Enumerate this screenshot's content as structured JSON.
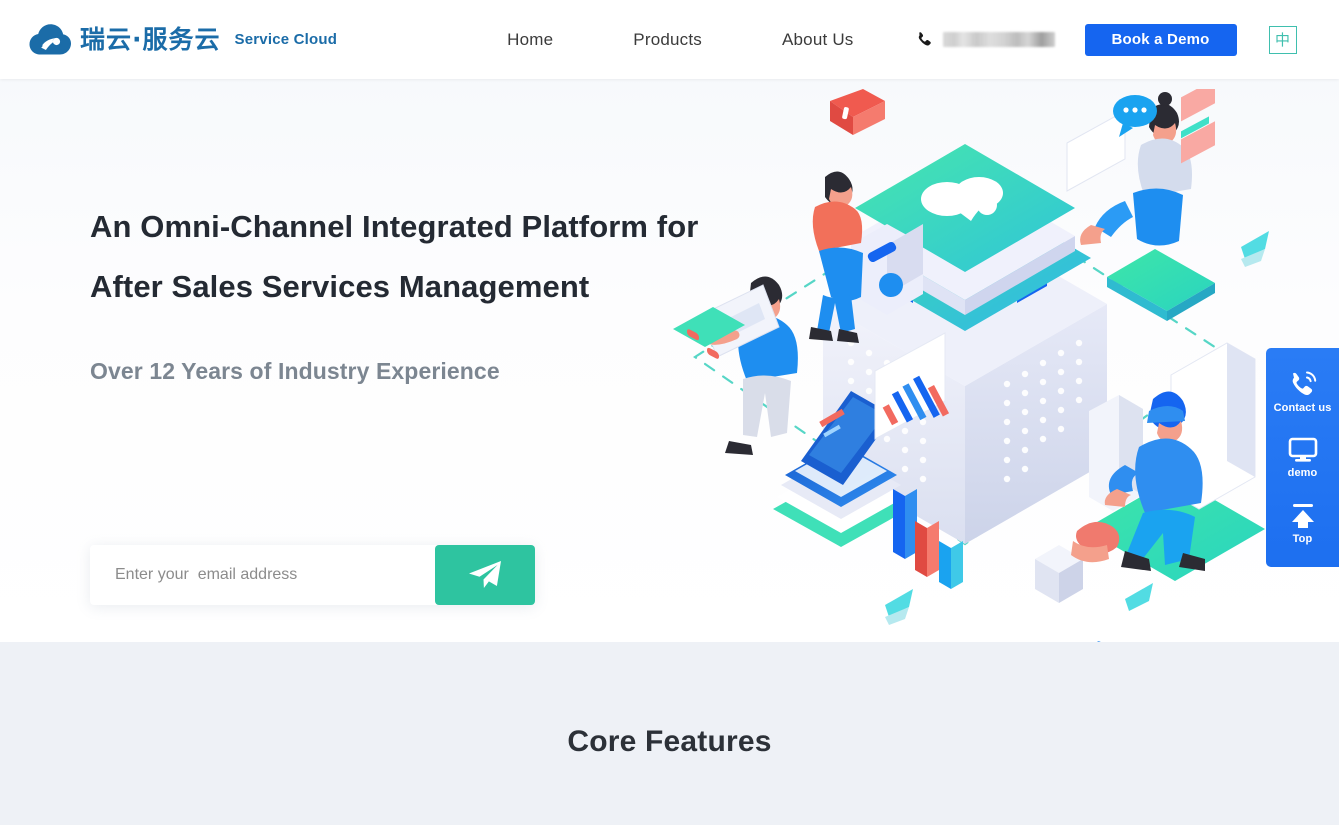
{
  "header": {
    "logo": {
      "icon": "cloud-logo-icon",
      "cn_text": "瑞云·服务云",
      "en_text": "Service Cloud",
      "color": "#1b6ca8"
    },
    "nav": [
      {
        "label": "Home",
        "name": "nav-home"
      },
      {
        "label": "Products",
        "name": "nav-products"
      },
      {
        "label": "About Us",
        "name": "nav-about-us"
      }
    ],
    "phone": {
      "icon": "phone-icon",
      "number": "",
      "redacted": true
    },
    "demo_button": {
      "label": "Book a Demo",
      "color": "#1565f0"
    },
    "language_button": {
      "label": "中",
      "color": "#3fbfae"
    }
  },
  "hero": {
    "title_line1": "An Omni-Channel Integrated Platform for",
    "title_line2": "After Sales Services Management",
    "subtitle": "Over 12 Years of Industry Experience",
    "subscribe": {
      "placeholder": "Enter your  email address",
      "value": "",
      "button_icon": "send-paper-plane-icon",
      "button_color": "#2ec4a0"
    },
    "illustration": {
      "name": "isometric-service-platform-illustration",
      "accent_green": "#34d1a4",
      "accent_blue": "#1565f0",
      "dashed_path_color": "#4fd1c5"
    }
  },
  "side_widget": {
    "background": "#1d6ff0",
    "items": [
      {
        "label": "Contact us",
        "icon": "phone-ring-icon",
        "name": "side-contact-us"
      },
      {
        "label": "demo",
        "icon": "monitor-icon",
        "name": "side-demo"
      },
      {
        "label": "Top",
        "icon": "arrow-up-icon",
        "name": "side-back-to-top"
      }
    ]
  },
  "features": {
    "title": "Core Features",
    "background": "#eef1f6"
  }
}
